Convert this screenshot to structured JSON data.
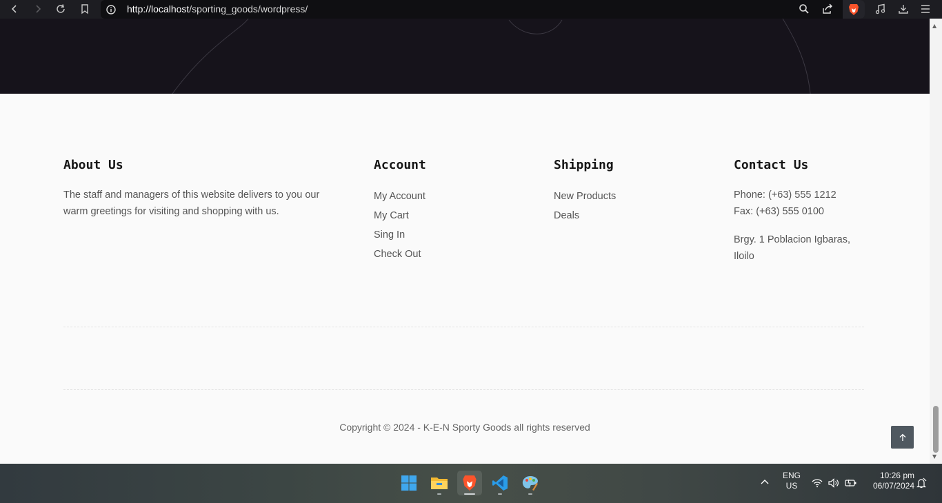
{
  "browser": {
    "url_host": "http://localhost",
    "url_path": "/sporting_goods/wordpress/"
  },
  "footer": {
    "about": {
      "heading": "About Us",
      "text": "The staff and managers of this website delivers to you our warm greetings for visiting and shopping with us."
    },
    "account": {
      "heading": "Account",
      "links": [
        "My Account",
        "My Cart",
        "Sing In",
        "Check Out"
      ]
    },
    "shipping": {
      "heading": "Shipping",
      "links": [
        "New Products",
        "Deals"
      ]
    },
    "contact": {
      "heading": "Contact Us",
      "phone": "Phone: (+63) 555 1212",
      "fax": "Fax: (+63) 555 0100",
      "address": "Brgy. 1 Poblacion Igbaras, Iloilo"
    },
    "copyright": "Copyright © 2024 - K-E-N Sporty Goods all rights reserved"
  },
  "taskbar": {
    "language_line1": "ENG",
    "language_line2": "US",
    "time": "10:26 pm",
    "date": "06/07/2024"
  },
  "colors": {
    "toolbar_bg": "#1d1d22",
    "hero_bg": "#16131b",
    "footer_bg": "#fafafa",
    "brave_orange": "#fb542b",
    "to_top_button": "#4f5860"
  }
}
